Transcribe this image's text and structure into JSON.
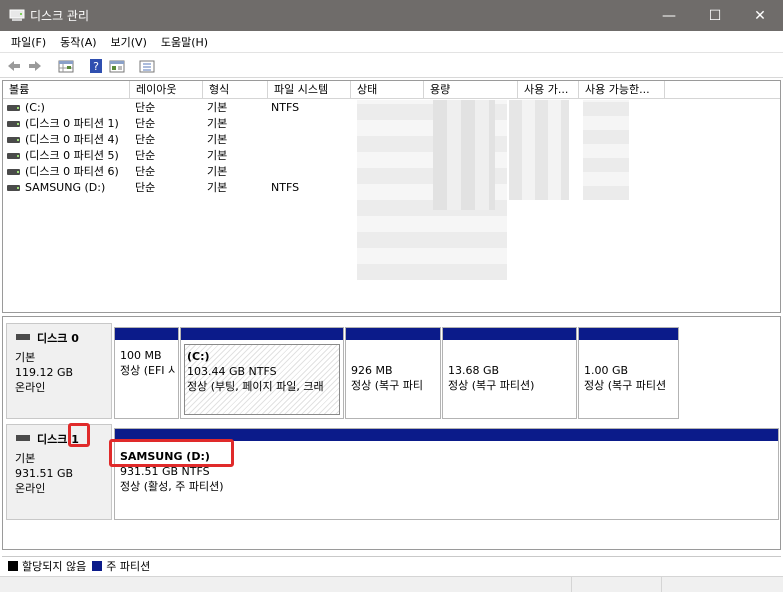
{
  "window": {
    "title": "디스크 관리",
    "min_glyph": "—",
    "max_glyph": "☐",
    "close_glyph": "✕"
  },
  "menu": [
    {
      "label": "파일(F)"
    },
    {
      "label": "동작(A)"
    },
    {
      "label": "보기(V)"
    },
    {
      "label": "도움말(H)"
    }
  ],
  "toolbar": {
    "icons": [
      "back-arrow-icon",
      "forward-arrow-icon",
      "properties-grid-icon",
      "help-icon",
      "console-view-icon",
      "list-view-icon"
    ]
  },
  "volume_list": {
    "headers": [
      "볼륨",
      "레이아웃",
      "형식",
      "파일 시스템",
      "상태",
      "용량",
      "사용 가...",
      "사용 가능한..."
    ],
    "rows": [
      {
        "volume": "(C:)",
        "layout": "단순",
        "type": "기본",
        "fs": "NTFS"
      },
      {
        "volume": "(디스크 0 파티션 1)",
        "layout": "단순",
        "type": "기본",
        "fs": ""
      },
      {
        "volume": "(디스크 0 파티션 4)",
        "layout": "단순",
        "type": "기본",
        "fs": ""
      },
      {
        "volume": "(디스크 0 파티션 5)",
        "layout": "단순",
        "type": "기본",
        "fs": ""
      },
      {
        "volume": "(디스크 0 파티션 6)",
        "layout": "단순",
        "type": "기본",
        "fs": ""
      },
      {
        "volume": "SAMSUNG (D:)",
        "layout": "단순",
        "type": "기본",
        "fs": "NTFS"
      }
    ]
  },
  "disks": [
    {
      "name": "디스크 0",
      "kind": "기본",
      "size": "119.12 GB",
      "status": "온라인",
      "partitions": [
        {
          "name": "",
          "size": "100 MB",
          "status": "정상 (EFI 시"
        },
        {
          "name": "(C:)",
          "size": "103.44 GB NTFS",
          "status": "정상 (부팅, 페이지 파일, 크래"
        },
        {
          "name": "",
          "size": "926 MB",
          "status": "정상 (복구 파티"
        },
        {
          "name": "",
          "size": "13.68 GB",
          "status": "정상 (복구 파티션)"
        },
        {
          "name": "",
          "size": "1.00 GB",
          "status": "정상 (복구 파티션"
        }
      ]
    },
    {
      "name_prefix": "디스크 ",
      "name_num": "1",
      "kind": "기본",
      "size": "931.51 GB",
      "status": "온라인",
      "partitions": [
        {
          "name": "SAMSUNG  (D:)",
          "size": "931.51 GB NTFS",
          "status": "정상 (활성, 주 파티션)"
        }
      ]
    }
  ],
  "legend": [
    {
      "label": "할당되지 않음",
      "color": "#000000"
    },
    {
      "label": "주 파티션",
      "color": "#0b1b8a"
    }
  ],
  "colors": {
    "title_bar": "#6f6c6a",
    "partition_bar": "#0b1b8a",
    "highlight": "#e02a2a"
  }
}
